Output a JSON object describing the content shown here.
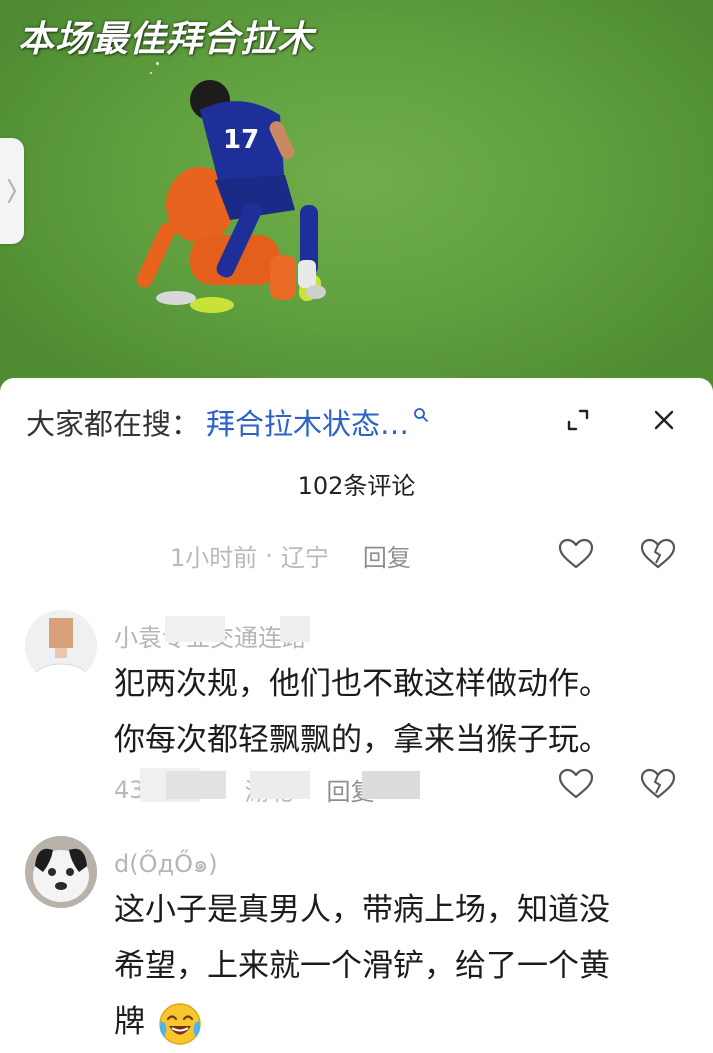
{
  "video": {
    "title_overlay": "本场最佳拜合拉木"
  },
  "sheet": {
    "search_prefix": "大家都在搜：",
    "search_suggestion": "拜合拉木状态…",
    "comment_count": "102条评论"
  },
  "comments": [
    {
      "time": "1小时前",
      "location": "辽宁",
      "reply_label": "回复"
    },
    {
      "username": "小袁专业交通连路",
      "text_line1": "犯两次规，他们也不敢这样做动作。",
      "text_line2": "你每次都轻飘飘的，拿来当猴子玩。",
      "time": "43",
      "location": "湖北",
      "reply_label": "回复"
    },
    {
      "username": "d(ŐдŐ๑)",
      "text_line1": "这小子是真男人，带病上场，知道没",
      "text_line2": "希望，上来就一个滑铲，给了一个黄",
      "text_line3": "牌",
      "emoji": "crying-laughing-face"
    }
  ],
  "colors": {
    "accent_link": "#2d62c8",
    "pitch_green": "#5f9f3e"
  }
}
